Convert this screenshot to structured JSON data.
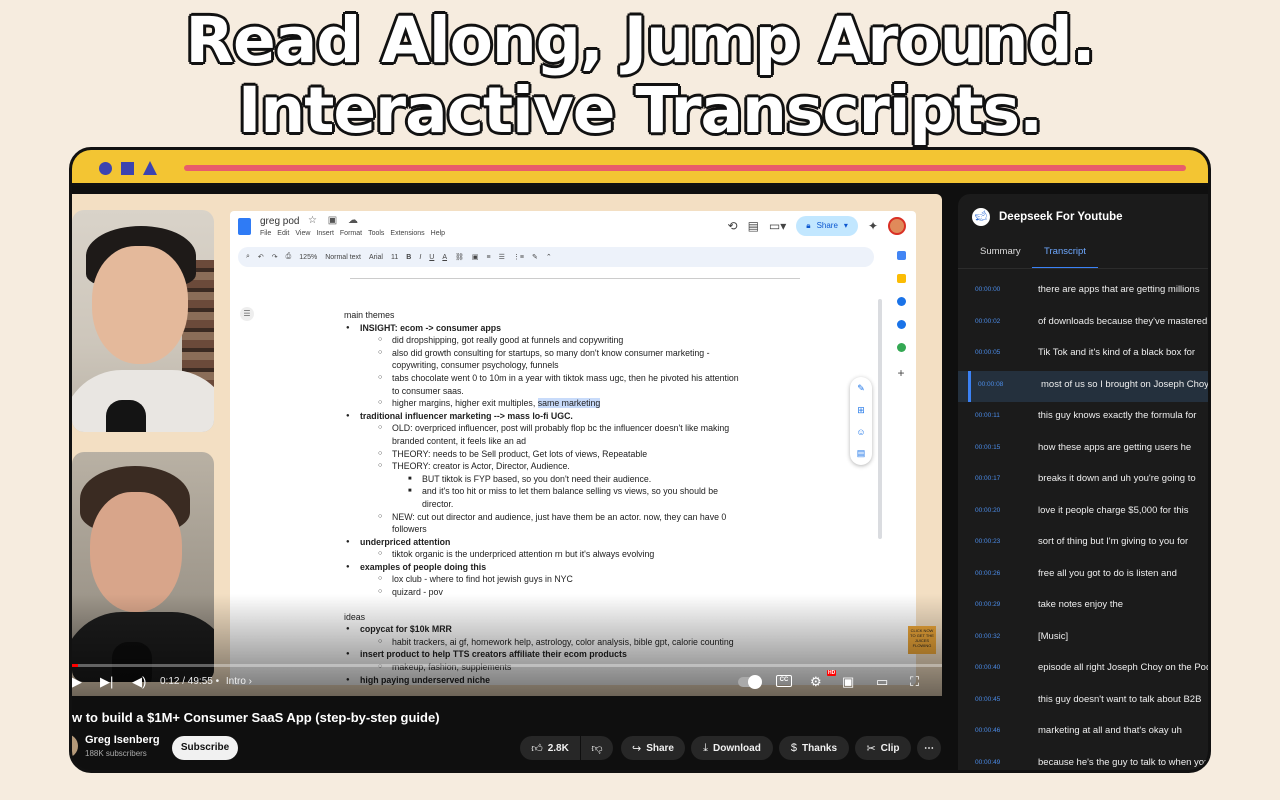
{
  "headline": {
    "line1": "Read Along, Jump Around.",
    "line2": "Interactive Transcripts."
  },
  "doc": {
    "title": "greg pod",
    "menu": [
      "File",
      "Edit",
      "View",
      "Insert",
      "Format",
      "Tools",
      "Extensions",
      "Help"
    ],
    "share_label": "Share",
    "toolbar": {
      "zoom": "125%",
      "style": "Normal text",
      "font": "Arial",
      "font_size": "11"
    },
    "lines": [
      {
        "level": 0,
        "bold": false,
        "text": "main themes"
      },
      {
        "level": 1,
        "bold": true,
        "text": "INSIGHT: ecom -> consumer apps"
      },
      {
        "level": 2,
        "bold": false,
        "text": "did dropshipping, got really good at funnels and copywriting"
      },
      {
        "level": 2,
        "bold": false,
        "text": "also did growth consulting for startups, so many don't know consumer marketing -"
      },
      {
        "level": 2,
        "bold": false,
        "text": "copywriting, consumer psychology, funnels",
        "cont": true
      },
      {
        "level": 2,
        "bold": false,
        "text": "tabs chocolate went 0 to 10m in a year with tiktok mass ugc, then he pivoted his attention"
      },
      {
        "level": 2,
        "bold": false,
        "text": "to consumer saas.",
        "cont": true
      },
      {
        "level": 2,
        "bold": false,
        "text": "higher margins, higher exit multiples, same marketing"
      },
      {
        "level": 1,
        "bold": true,
        "text": "traditional influencer marketing --> mass lo-fi UGC."
      },
      {
        "level": 2,
        "bold": false,
        "text": "OLD: overpriced influencer, post will probably flop bc the influencer doesn't like making"
      },
      {
        "level": 2,
        "bold": false,
        "text": "branded content, it feels like an ad",
        "cont": true
      },
      {
        "level": 2,
        "bold": false,
        "text": "THEORY: needs to be Sell product, Get lots of views, Repeatable"
      },
      {
        "level": 2,
        "bold": false,
        "text": "THEORY: creator is Actor, Director, Audience."
      },
      {
        "level": 3,
        "bold": false,
        "text": "BUT tiktok is FYP based, so you don't need their audience."
      },
      {
        "level": 3,
        "bold": false,
        "text": "and it's too hit or miss to let them balance selling vs views, so you should be"
      },
      {
        "level": 3,
        "bold": false,
        "text": "director.",
        "cont": true
      },
      {
        "level": 2,
        "bold": false,
        "text": "NEW: cut out director and audience, just have them be an actor. now, they can have 0"
      },
      {
        "level": 2,
        "bold": false,
        "text": "followers",
        "cont": true
      },
      {
        "level": 1,
        "bold": true,
        "text": "underpriced attention"
      },
      {
        "level": 2,
        "bold": false,
        "text": "tiktok organic is the underpriced attention rn but it's always evolving"
      },
      {
        "level": 1,
        "bold": true,
        "text": "examples of people doing this"
      },
      {
        "level": 2,
        "bold": false,
        "text": "lox club - where to find hot jewish guys in NYC"
      },
      {
        "level": 2,
        "bold": false,
        "text": "quizard - pov"
      },
      {
        "level": -1,
        "bold": false,
        "text": ""
      },
      {
        "level": 0,
        "bold": false,
        "text": "ideas"
      },
      {
        "level": 1,
        "bold": true,
        "text": "copycat for $10k MRR"
      },
      {
        "level": 2,
        "bold": false,
        "text": "habit trackers, ai gf, homework help, astrology, color analysis, bible gpt, calorie counting"
      },
      {
        "level": 1,
        "bold": true,
        "text": "insert product to help TTS creators affiliate their ecom products"
      },
      {
        "level": 2,
        "bold": false,
        "text": "makeup, fashion, supplements"
      },
      {
        "level": 1,
        "bold": true,
        "text": "high paying underserved niche"
      }
    ]
  },
  "promo_text": "CLICK NOW TO GET THE JUICES FLOWING",
  "player": {
    "time": "0:12 / 49:55",
    "chapter": "Intro",
    "progress": 0.004,
    "hd_badge": "HD"
  },
  "video": {
    "title": "w to build a $1M+ Consumer SaaS App (step-by-step guide)",
    "channel": "Greg Isenberg",
    "subscribers": "188K subscribers",
    "subscribe_label": "Subscribe",
    "likes": "2.8K",
    "share_label": "Share",
    "download_label": "Download",
    "thanks_label": "Thanks",
    "clip_label": "Clip",
    "more_label": "⋯"
  },
  "panel": {
    "title": "Deepseek For Youtube",
    "tabs": [
      "Summary",
      "Transcript"
    ],
    "active_tab": "Transcript",
    "transcript": [
      {
        "time": "00:00:00",
        "text": "there are apps that are getting millions"
      },
      {
        "time": "00:00:02",
        "text": "of downloads because they've mastered"
      },
      {
        "time": "00:00:05",
        "text": "Tik Tok and it's kind of a black box for"
      },
      {
        "time": "00:00:08",
        "text": "most of us so I brought on Joseph Choy",
        "active": true
      },
      {
        "time": "00:00:11",
        "text": "this guy knows exactly the formula for"
      },
      {
        "time": "00:00:15",
        "text": "how these apps are getting users he"
      },
      {
        "time": "00:00:17",
        "text": "breaks it down and uh you're going to"
      },
      {
        "time": "00:00:20",
        "text": "love it people charge $5,000 for this"
      },
      {
        "time": "00:00:23",
        "text": "sort of thing but I'm giving to you for"
      },
      {
        "time": "00:00:26",
        "text": "free all you got to do is listen and"
      },
      {
        "time": "00:00:29",
        "text": "take notes enjoy the"
      },
      {
        "time": "00:00:32",
        "text": "[Music]"
      },
      {
        "time": "00:00:40",
        "text": "episode all right Joseph Choy on the Pod"
      },
      {
        "time": "00:00:45",
        "text": "this guy doesn't want to talk about B2B"
      },
      {
        "time": "00:00:46",
        "text": "marketing at all and that's okay uh"
      },
      {
        "time": "00:00:49",
        "text": "because he's the guy to talk to when you"
      }
    ]
  },
  "colors": {
    "background": "#f6ecdf",
    "frame_bar": "#f3c533",
    "frame_line": "#e85c6b",
    "shapes": "#3c44b0",
    "panel_bg": "#1b1b1b",
    "accent_blue": "#3b82f6"
  }
}
